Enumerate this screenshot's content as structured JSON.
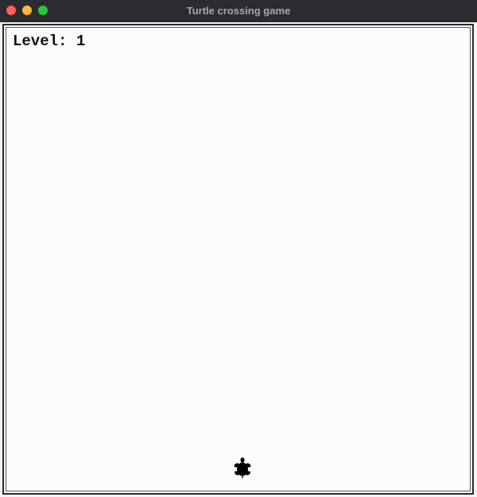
{
  "window": {
    "title": "Turtle crossing game",
    "traffic_lights": {
      "close_color": "#ff5f57",
      "minimize_color": "#febc2e",
      "zoom_color": "#28c840"
    }
  },
  "game": {
    "level_text": "Level: 1",
    "player_icon": "turtle-icon",
    "background_color": "#fdfbfe"
  }
}
